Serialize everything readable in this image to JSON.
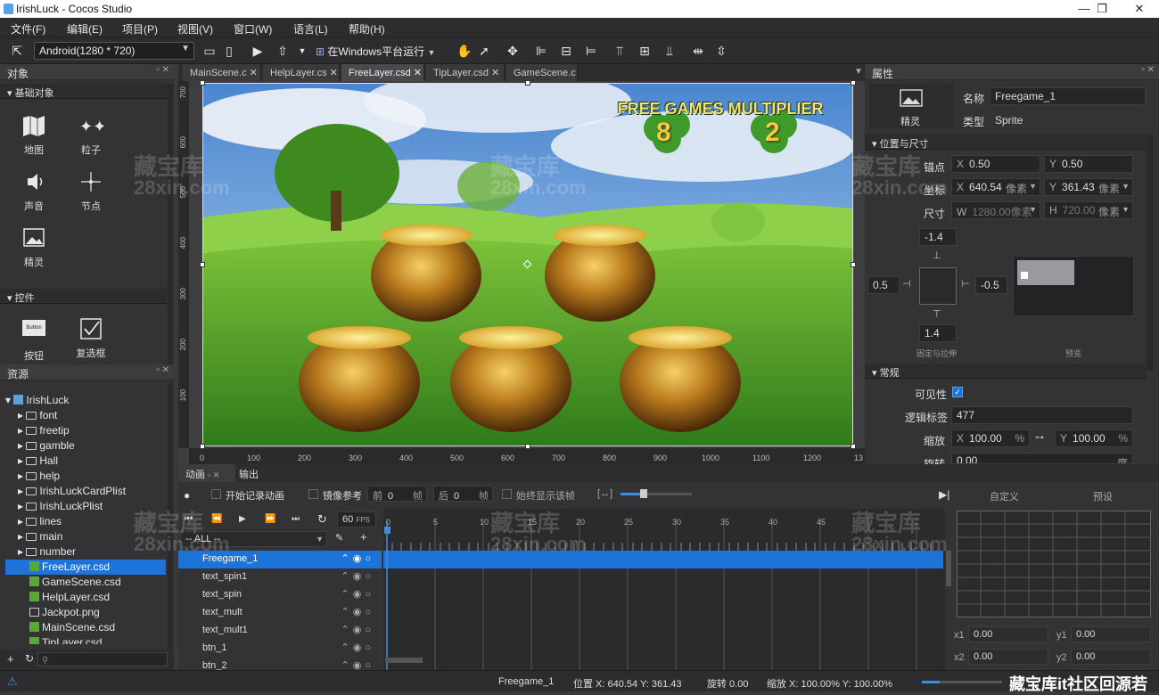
{
  "window": {
    "title": "IrishLuck - Cocos Studio",
    "min": "—",
    "max": "❐",
    "close": "✕"
  },
  "menu": [
    "文件(F)",
    "编辑(E)",
    "项目(P)",
    "视图(V)",
    "窗口(W)",
    "语言(L)",
    "帮助(H)"
  ],
  "toolbar": {
    "device": "Android(1280 * 720)",
    "run": "在Windows平台运行"
  },
  "objects_panel": {
    "title": "对象",
    "basic_section": "基础对象",
    "basic_items": [
      "地图",
      "粒子",
      "声音",
      "节点",
      "精灵"
    ],
    "controls_section": "控件",
    "control_items": [
      "按钮",
      "复选框"
    ],
    "button_icon_text": "Button"
  },
  "resources_panel": {
    "title": "资源",
    "root": "IrishLuck",
    "folders": [
      "font",
      "freetip",
      "gamble",
      "Hall",
      "help",
      "IrishLuckCardPlist",
      "IrishLuckPlist",
      "lines",
      "main",
      "number"
    ],
    "files": [
      "FreeLayer.csd",
      "GameScene.csd",
      "HelpLayer.csd",
      "Jackpot.png",
      "MainScene.csd",
      "TipLayer.csd"
    ]
  },
  "tabs": [
    "MainScene.c",
    "HelpLayer.cs",
    "FreeLayer.csd",
    "TipLayer.csd",
    "GameScene.c"
  ],
  "canvas": {
    "banner": "FREE GAMES MULTIPLIER",
    "multiplier_left": "8",
    "multiplier_right": "2",
    "ruler_x": [
      "0",
      "100",
      "200",
      "300",
      "400",
      "500",
      "600",
      "700",
      "800",
      "900",
      "1000",
      "1100",
      "1200",
      "13"
    ],
    "ruler_y": [
      "700",
      "600",
      "500",
      "400",
      "300",
      "200",
      "100"
    ]
  },
  "properties": {
    "title": "属性",
    "sprite_label": "精灵",
    "name_label": "名称",
    "name_value": "Freegame_1",
    "type_label": "类型",
    "type_value": "Sprite",
    "pos_section": "位置与尺寸",
    "anchor_label": "锚点",
    "anchor_x": "0.50",
    "anchor_y": "0.50",
    "pos_label": "坐标",
    "pos_x": "640.54",
    "pos_y": "361.43",
    "unit": "像素",
    "size_label": "尺寸",
    "size_w": "1280.00像素",
    "size_h": "720.00",
    "margin_top": "-1.4",
    "margin_left": "0.5",
    "margin_right": "-0.5",
    "margin_bottom": "1.4",
    "stretch_label": "固定与拉伸",
    "preview_label": "预览",
    "general_section": "常规",
    "visible_label": "可见性",
    "tag_label": "逻辑标签",
    "tag_value": "477",
    "scale_label": "缩放",
    "scale_x": "100.00",
    "scale_y": "100.00",
    "percent": "%",
    "rotate_label": "旋转",
    "rotate_value": "0.00",
    "rotate_unit": "度"
  },
  "animation": {
    "tab_anim": "动画",
    "tab_output": "输出",
    "record_label": "开始记录动画",
    "mirror_label": "镜像参考",
    "prev_label": "前",
    "prev_value": "0",
    "next_label": "后",
    "next_value": "0",
    "frame_unit": "帧",
    "always_show": "始终显示该帧",
    "fps_value": "60",
    "fps_label": "FPS",
    "filter": "-- ALL --",
    "frame_ticks": [
      "0",
      "5",
      "10",
      "15",
      "20",
      "25",
      "30",
      "35",
      "40",
      "45"
    ],
    "tracks": [
      "Freegame_1",
      "text_spin1",
      "text_spin",
      "text_mult",
      "text_mult1",
      "btn_1",
      "btn_2"
    ],
    "custom_tab": "自定义",
    "preset_tab": "预设",
    "x1_label": "x1",
    "x1_value": "0.00",
    "y1_label": "y1",
    "y1_value": "0.00",
    "x2_label": "x2",
    "x2_value": "0.00",
    "y2_label": "y2",
    "y2_value": "0.00"
  },
  "status": {
    "node": "Freegame_1",
    "position": "位置 X: 640.54  Y: 361.43",
    "rotation": "旋转 0.00",
    "scale": "缩放 X: 100.00%  Y: 100.00%",
    "watermark_text": "藏宝库it社区回源若"
  },
  "watermark": {
    "cn": "藏宝库",
    "en": "28xin.com"
  }
}
